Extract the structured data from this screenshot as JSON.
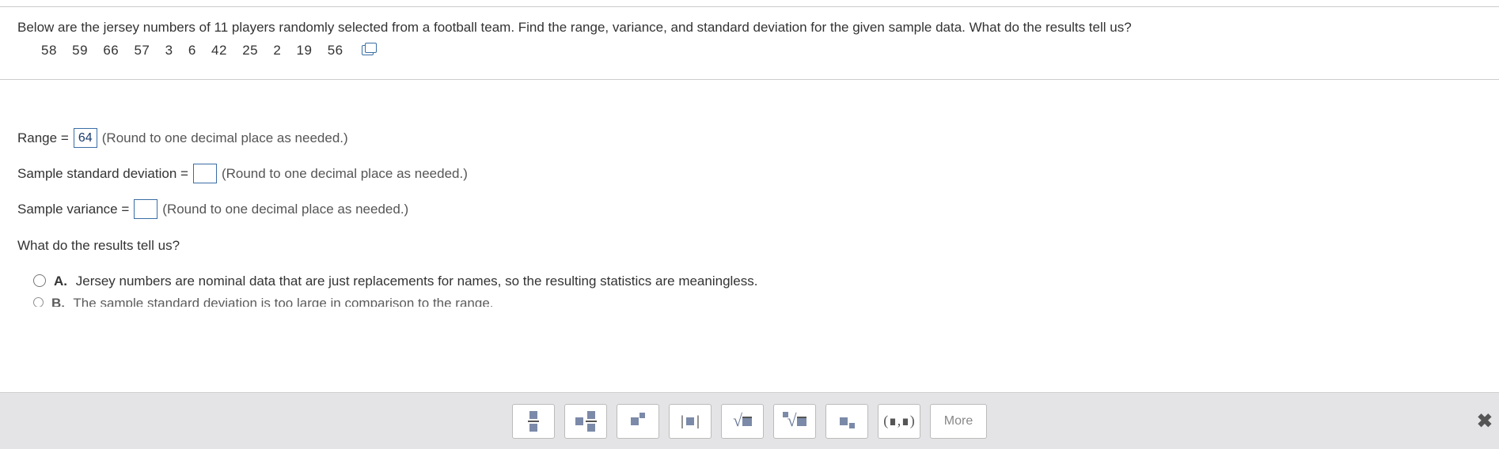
{
  "question": {
    "prompt": "Below are the jersey numbers of 11 players randomly selected from a football team. Find the range, variance, and standard deviation for the given sample data. What do the results tell us?",
    "data": [
      "58",
      "59",
      "66",
      "57",
      "3",
      "6",
      "42",
      "25",
      "2",
      "19",
      "56"
    ]
  },
  "answers": {
    "range_label": "Range =",
    "range_value": "64",
    "range_hint": "(Round to one decimal place as needed.)",
    "stddev_label": "Sample standard deviation =",
    "stddev_value": "",
    "stddev_hint": "(Round to one decimal place as needed.)",
    "variance_label": "Sample variance =",
    "variance_value": "",
    "variance_hint": "(Round to one decimal place as needed.)",
    "interpretation_q": "What do the results tell us?"
  },
  "choices": {
    "A": {
      "letter": "A.",
      "text": "Jersey numbers are nominal data that are just replacements for names, so the resulting statistics are meaningless."
    },
    "B": {
      "letter": "B.",
      "text": "The sample standard deviation is too large in comparison to the range."
    }
  },
  "toolbar": {
    "more": "More",
    "interval": "(∎,∎)"
  }
}
